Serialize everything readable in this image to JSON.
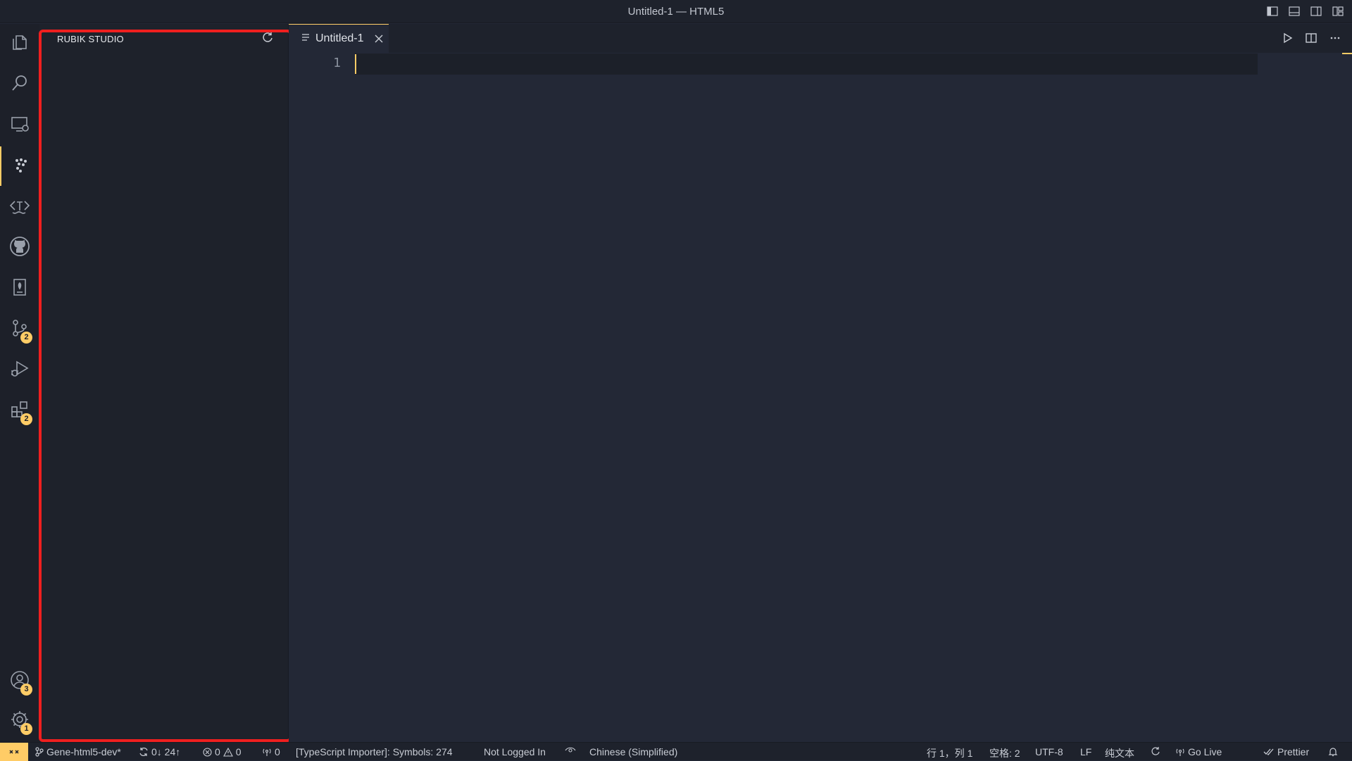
{
  "window": {
    "title": "Untitled-1 — HTML5"
  },
  "activity_bar": {
    "items": [
      {
        "name": "explorer-icon"
      },
      {
        "name": "search-icon"
      },
      {
        "name": "remote-explorer-icon"
      },
      {
        "name": "rubik-studio-icon",
        "active": true
      },
      {
        "name": "tag-icon"
      },
      {
        "name": "github-icon"
      },
      {
        "name": "bookmark-icon"
      },
      {
        "name": "source-control-icon",
        "badge": "2"
      },
      {
        "name": "run-debug-icon"
      },
      {
        "name": "extensions-icon",
        "badge": "2"
      }
    ],
    "accounts_badge": "3",
    "settings_badge": "1"
  },
  "sidebar": {
    "title": "RUBIK STUDIO"
  },
  "editor": {
    "tab_label": "Untitled-1",
    "line_number": "1"
  },
  "statusbar": {
    "branch": "Gene-html5-dev*",
    "sync": "0↓ 24↑",
    "errors": "0",
    "warnings": "0",
    "ports": "0",
    "ts_importer": "[TypeScript Importer]: Symbols: 274",
    "login": "Not Logged In",
    "language_pack": "Chinese (Simplified)",
    "position": "行 1，列 1",
    "spaces": "空格: 2",
    "encoding": "UTF-8",
    "eol": "LF",
    "mode": "纯文本",
    "go_live": "Go Live",
    "prettier": "Prettier"
  },
  "colors": {
    "accent": "#ffcc66",
    "highlight_box": "#ef1f1f",
    "background": "#232836"
  }
}
